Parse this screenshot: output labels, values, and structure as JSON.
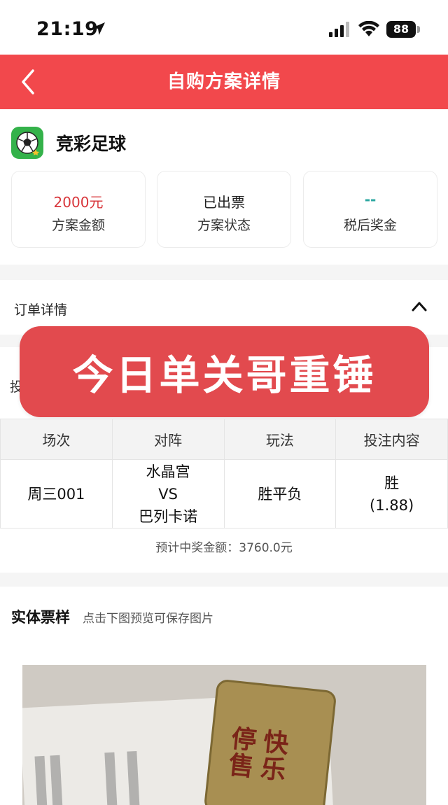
{
  "status_bar": {
    "time": "21:19",
    "battery": "88"
  },
  "header": {
    "title": "自购方案详情"
  },
  "lottery": {
    "name": "竞彩足球"
  },
  "summary": [
    {
      "value": "2000元",
      "label": "方案金额"
    },
    {
      "value": "已出票",
      "label": "方案状态"
    },
    {
      "value": "--",
      "label": "税后奖金"
    }
  ],
  "order": {
    "title": "订单详情"
  },
  "bet_info": {
    "label": "投注信息"
  },
  "overlay": {
    "text": "今日单关哥重锤"
  },
  "table": {
    "headers": [
      "场次",
      "对阵",
      "玩法",
      "投注内容"
    ],
    "rows": [
      {
        "match_no": "周三001",
        "home": "水晶宫",
        "vs": "VS",
        "away": "巴列卡诺",
        "play": "胜平负",
        "pick": "胜",
        "odds": "(1.88)"
      }
    ]
  },
  "expected_prize": "预计中奖金额：3760.0元",
  "ticket": {
    "title": "实体票样",
    "hint": "点击下图预览可保存图片",
    "photo_text": [
      "快乐",
      "停售"
    ]
  },
  "colors": {
    "header": "#f2484c",
    "amount": "#d8363b",
    "prize": "#2aa6a0",
    "overlay": "#e24a4e"
  }
}
